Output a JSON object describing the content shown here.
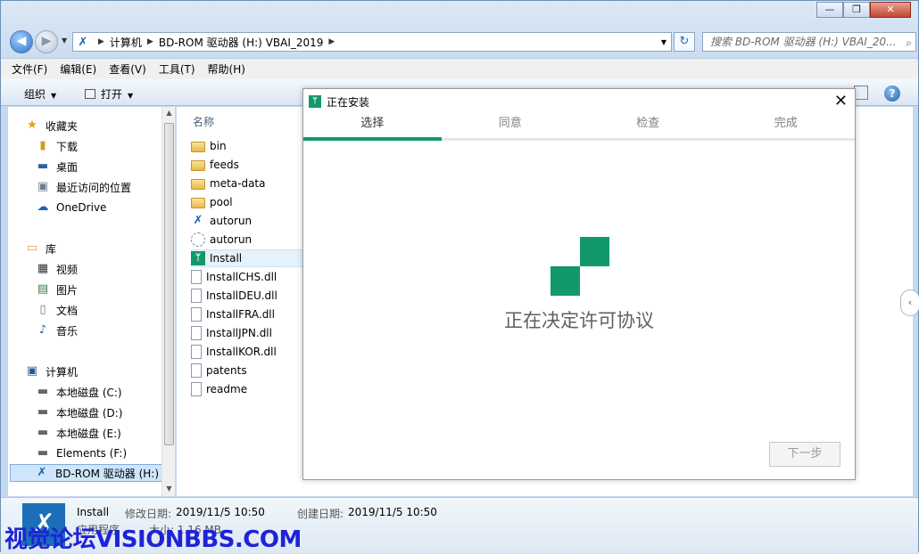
{
  "window": {
    "caption_min": "—",
    "caption_max": "❐",
    "caption_close": "✕"
  },
  "address": {
    "crumbs": [
      "计算机",
      "BD-ROM 驱动器 (H:) VBAI_2019"
    ],
    "search_placeholder": "搜索 BD-ROM 驱动器 (H:) VBAI_20..."
  },
  "menubar": [
    "文件(F)",
    "编辑(E)",
    "查看(V)",
    "工具(T)",
    "帮助(H)"
  ],
  "cmdbar": {
    "organize": "组织",
    "open": "打开"
  },
  "nav": {
    "favorites": {
      "label": "收藏夹",
      "items": [
        "下载",
        "桌面",
        "最近访问的位置",
        "OneDrive"
      ]
    },
    "libraries": {
      "label": "库",
      "items": [
        "视频",
        "图片",
        "文档",
        "音乐"
      ]
    },
    "computer": {
      "label": "计算机",
      "items": [
        "本地磁盘 (C:)",
        "本地磁盘 (D:)",
        "本地磁盘 (E:)",
        "Elements (F:)",
        "BD-ROM 驱动器 (H:)"
      ]
    }
  },
  "files": {
    "column_name": "名称",
    "items": [
      {
        "name": "bin",
        "icon": "folder-icon"
      },
      {
        "name": "feeds",
        "icon": "folder-icon"
      },
      {
        "name": "meta-data",
        "icon": "folder-icon"
      },
      {
        "name": "pool",
        "icon": "folder-icon"
      },
      {
        "name": "autorun",
        "icon": "ni-icon"
      },
      {
        "name": "autorun",
        "icon": "config-icon"
      },
      {
        "name": "Install",
        "icon": "installer-icon",
        "selected": true
      },
      {
        "name": "InstallCHS.dll",
        "icon": "dll-icon"
      },
      {
        "name": "InstallDEU.dll",
        "icon": "dll-icon"
      },
      {
        "name": "InstallFRA.dll",
        "icon": "dll-icon"
      },
      {
        "name": "InstallJPN.dll",
        "icon": "dll-icon"
      },
      {
        "name": "InstallKOR.dll",
        "icon": "dll-icon"
      },
      {
        "name": "patents",
        "icon": "text-icon"
      },
      {
        "name": "readme",
        "icon": "document-icon"
      }
    ]
  },
  "details": {
    "name": "Install",
    "modified_label": "修改日期:",
    "modified_value": "2019/11/5 10:50",
    "created_label": "创建日期:",
    "created_value": "2019/11/5 10:50",
    "type": "应用程序",
    "size": "大小: 1.16 MB"
  },
  "watermark": "视觉论坛VISIONBBS.COM",
  "dialog": {
    "title": "正在安装",
    "close": "✕",
    "steps": [
      "选择",
      "同意",
      "检查",
      "完成"
    ],
    "active_step": 0,
    "status_text": "正在决定许可协议",
    "next_button": "下一步",
    "accent_color": "#13986a"
  }
}
